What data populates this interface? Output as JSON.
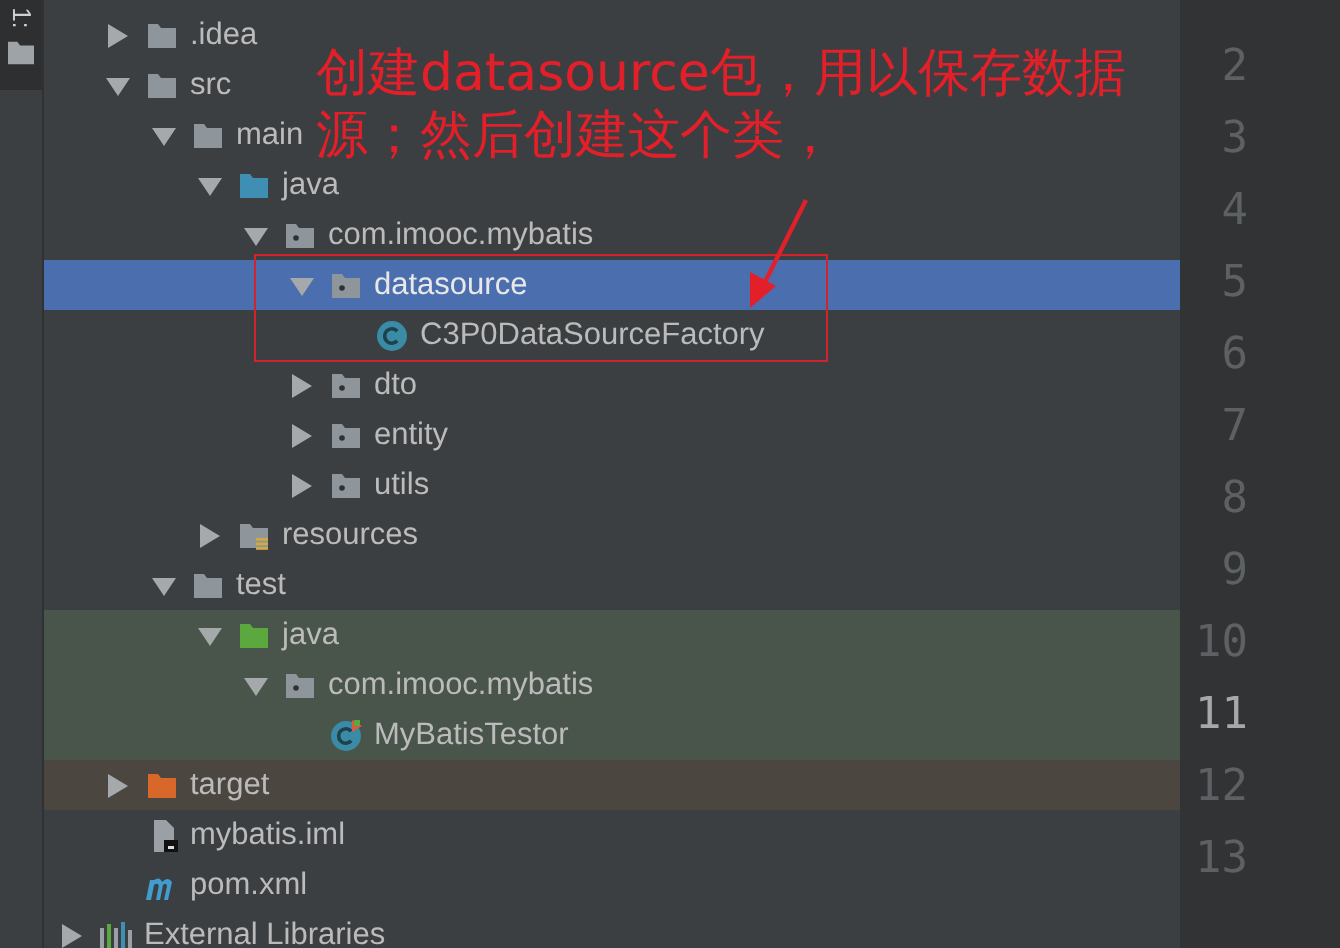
{
  "tool_strip": {
    "label": "1:"
  },
  "tree": [
    {
      "label": ".idea",
      "kind": "folder",
      "expanded": false,
      "selected": false
    },
    {
      "label": "src",
      "kind": "folder",
      "expanded": true,
      "selected": false,
      "children": [
        {
          "label": "main",
          "kind": "folder",
          "expanded": true,
          "selected": false,
          "children": [
            {
              "label": "java",
              "kind": "source-root",
              "expanded": true,
              "selected": false,
              "children": [
                {
                  "label": "com.imooc.mybatis",
                  "kind": "package",
                  "expanded": true,
                  "selected": false,
                  "children": [
                    {
                      "label": "datasource",
                      "kind": "package",
                      "expanded": true,
                      "selected": true,
                      "children": [
                        {
                          "label": "C3P0DataSourceFactory",
                          "kind": "class",
                          "selected": false
                        }
                      ]
                    },
                    {
                      "label": "dto",
                      "kind": "package",
                      "expanded": false,
                      "selected": false
                    },
                    {
                      "label": "entity",
                      "kind": "package",
                      "expanded": false,
                      "selected": false
                    },
                    {
                      "label": "utils",
                      "kind": "package",
                      "expanded": false,
                      "selected": false
                    }
                  ]
                }
              ]
            },
            {
              "label": "resources",
              "kind": "resources",
              "expanded": false,
              "selected": false
            }
          ]
        },
        {
          "label": "test",
          "kind": "folder",
          "expanded": true,
          "selected": false,
          "children": [
            {
              "label": "java",
              "kind": "test-root",
              "expanded": true,
              "selected": false,
              "children": [
                {
                  "label": "com.imooc.mybatis",
                  "kind": "package",
                  "expanded": true,
                  "selected": false,
                  "children": [
                    {
                      "label": "MyBatisTestor",
                      "kind": "test-class",
                      "selected": false
                    }
                  ]
                }
              ]
            }
          ]
        }
      ]
    },
    {
      "label": "target",
      "kind": "excluded",
      "expanded": false,
      "selected": false
    },
    {
      "label": "mybatis.iml",
      "kind": "module-file",
      "selected": false
    },
    {
      "label": "pom.xml",
      "kind": "maven-file",
      "selected": false
    }
  ],
  "external_libraries": {
    "label": "External Libraries",
    "expanded": false,
    "selected": false
  },
  "annotation": {
    "text": "创建datasource包，用以保存数据源；然后创建这个类，"
  },
  "line_numbers": [
    {
      "number": "2",
      "current": false
    },
    {
      "number": "3",
      "current": false
    },
    {
      "number": "4",
      "current": false
    },
    {
      "number": "5",
      "current": false
    },
    {
      "number": "6",
      "current": false
    },
    {
      "number": "7",
      "current": false
    },
    {
      "number": "8",
      "current": false
    },
    {
      "number": "9",
      "current": false
    },
    {
      "number": "10",
      "current": false
    },
    {
      "number": "11",
      "current": true
    },
    {
      "number": "12",
      "current": false
    },
    {
      "number": "13",
      "current": false
    }
  ]
}
